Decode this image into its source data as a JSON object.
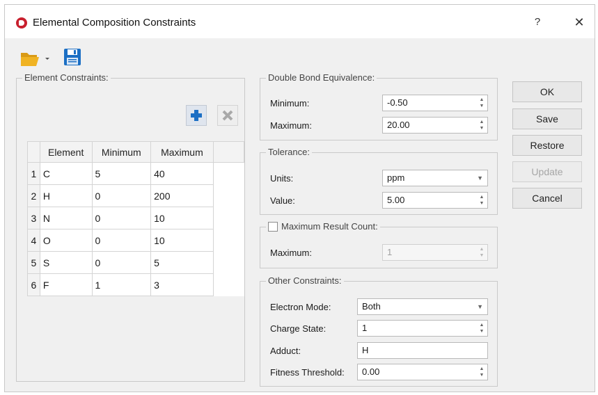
{
  "window": {
    "title": "Elemental Composition Constraints",
    "help_glyph": "?",
    "close_glyph": "✕"
  },
  "toolbar": {
    "open_icon": "folder-open-icon",
    "open_dropdown_icon": "dropdown-caret-icon",
    "save_icon": "save-floppy-icon"
  },
  "element_constraints": {
    "title": "Element Constraints:",
    "add_icon": "plus-icon",
    "remove_icon": "x-icon",
    "columns": [
      "Element",
      "Minimum",
      "Maximum"
    ],
    "rows": [
      {
        "num": "1",
        "element": "C",
        "minimum": "5",
        "maximum": "40"
      },
      {
        "num": "2",
        "element": "H",
        "minimum": "0",
        "maximum": "200"
      },
      {
        "num": "3",
        "element": "N",
        "minimum": "0",
        "maximum": "10"
      },
      {
        "num": "4",
        "element": "O",
        "minimum": "0",
        "maximum": "10"
      },
      {
        "num": "5",
        "element": "S",
        "minimum": "0",
        "maximum": "5"
      },
      {
        "num": "6",
        "element": "F",
        "minimum": "1",
        "maximum": "3"
      }
    ]
  },
  "dbe": {
    "title": "Double Bond Equivalence:",
    "min_label": "Minimum:",
    "min_value": "-0.50",
    "max_label": "Maximum:",
    "max_value": "20.00"
  },
  "tolerance": {
    "title": "Tolerance:",
    "units_label": "Units:",
    "units_value": "ppm",
    "value_label": "Value:",
    "value": "5.00"
  },
  "max_result": {
    "title": "Maximum Result Count:",
    "checked": false,
    "max_label": "Maximum:",
    "max_value": "1"
  },
  "other": {
    "title": "Other Constraints:",
    "electron_label": "Electron Mode:",
    "electron_value": "Both",
    "charge_label": "Charge State:",
    "charge_value": "1",
    "adduct_label": "Adduct:",
    "adduct_value": "H",
    "fitness_label": "Fitness Threshold:",
    "fitness_value": "0.00"
  },
  "buttons": {
    "ok": "OK",
    "save": "Save",
    "restore": "Restore",
    "update": "Update",
    "cancel": "Cancel"
  },
  "colors": {
    "accent_blue": "#1c6fc4",
    "brand_red": "#c8202e",
    "folder_yellow": "#f0b323"
  }
}
